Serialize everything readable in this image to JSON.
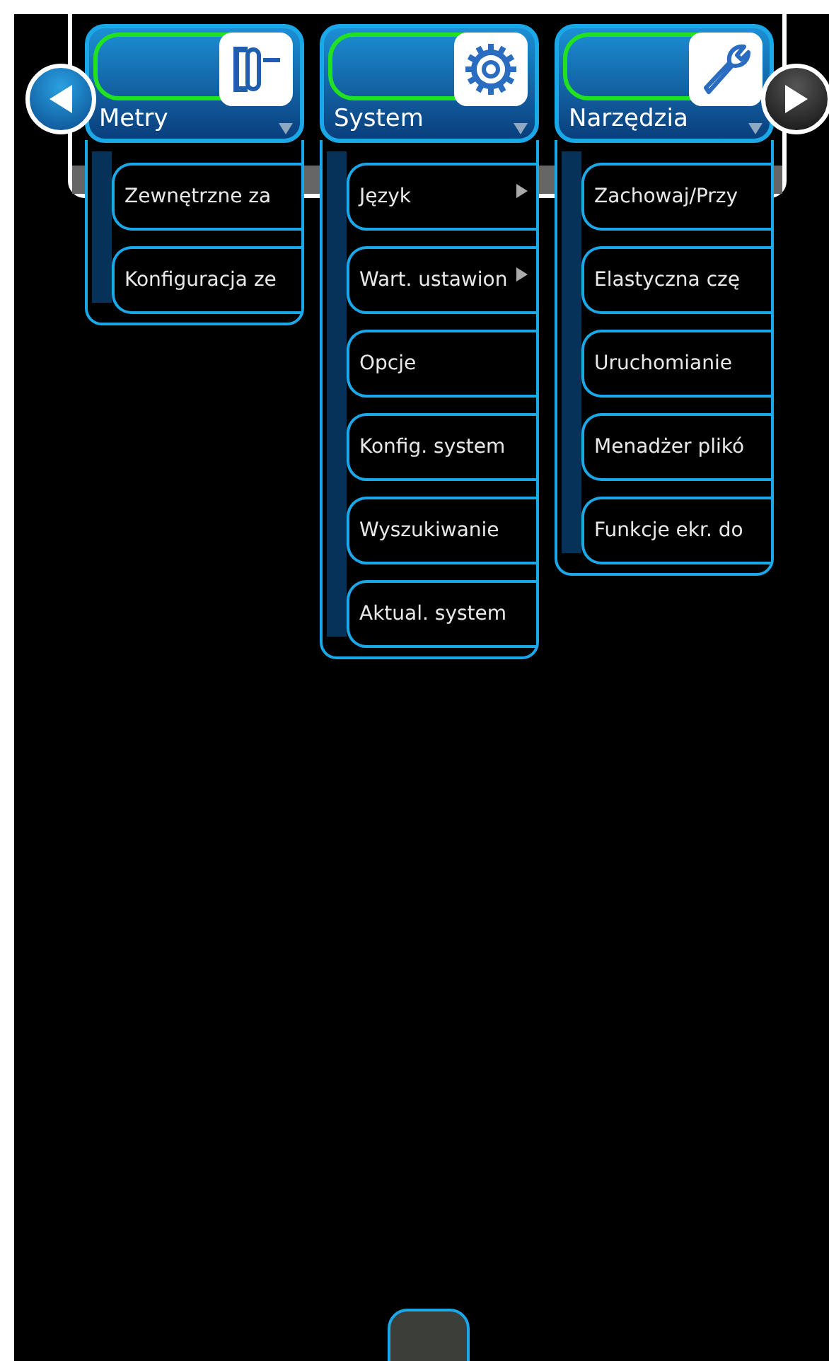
{
  "menus": [
    {
      "label": "Metry",
      "kind": "meter",
      "items": [
        {
          "label": "Zewnętrzne za",
          "submenu": false
        },
        {
          "label": "Konfiguracja ze",
          "submenu": false
        }
      ]
    },
    {
      "label": "System",
      "kind": "gear",
      "items": [
        {
          "label": "Język",
          "submenu": true
        },
        {
          "label": "Wart. ustawion",
          "submenu": true
        },
        {
          "label": "Opcje",
          "submenu": false
        },
        {
          "label": "Konfig. system",
          "submenu": false
        },
        {
          "label": "Wyszukiwanie",
          "submenu": false
        },
        {
          "label": "Aktual. system",
          "submenu": false
        }
      ]
    },
    {
      "label": "Narzędzia",
      "kind": "wrench",
      "items": [
        {
          "label": "Zachowaj/Przy",
          "submenu": false
        },
        {
          "label": "Elastyczna czę",
          "submenu": false
        },
        {
          "label": "Uruchomianie",
          "submenu": false
        },
        {
          "label": "Menadżer plikó",
          "submenu": false
        },
        {
          "label": "Funkcje ekr. do",
          "submenu": false
        }
      ]
    }
  ]
}
